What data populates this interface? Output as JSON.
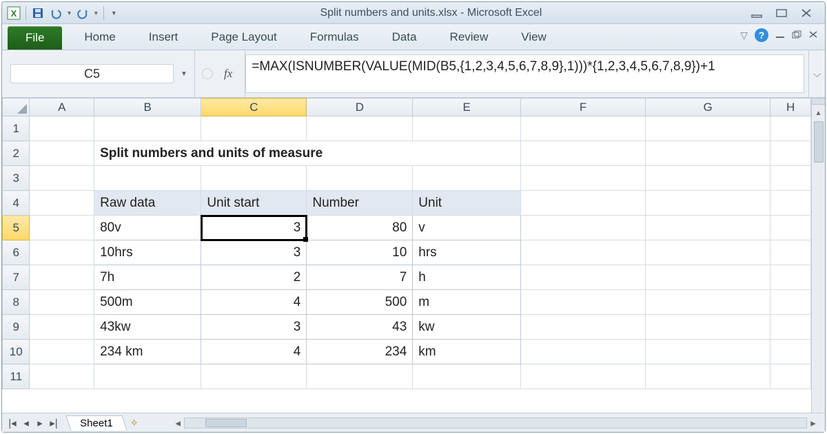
{
  "window": {
    "title": "Split numbers and units.xlsx - Microsoft Excel"
  },
  "ribbon": {
    "file": "File",
    "tabs": [
      "Home",
      "Insert",
      "Page Layout",
      "Formulas",
      "Data",
      "Review",
      "View"
    ]
  },
  "name_box": "C5",
  "fx_label": "fx",
  "formula": "=MAX(ISNUMBER(VALUE(MID(B5,{1,2,3,4,5,6,7,8,9},1)))*{1,2,3,4,5,6,7,8,9})+1",
  "columns": [
    "A",
    "B",
    "C",
    "D",
    "E",
    "F",
    "G",
    "H"
  ],
  "active_col": "C",
  "active_row": 5,
  "title_text": "Split numbers and units of measure",
  "headers": {
    "b": "Raw data",
    "c": "Unit start",
    "d": "Number",
    "e": "Unit"
  },
  "rows": [
    {
      "raw": "80v",
      "start": "3",
      "num": "80",
      "unit": "v"
    },
    {
      "raw": "10hrs",
      "start": "3",
      "num": "10",
      "unit": "hrs"
    },
    {
      "raw": "7h",
      "start": "2",
      "num": "7",
      "unit": "h"
    },
    {
      "raw": "500m",
      "start": "4",
      "num": "500",
      "unit": "m"
    },
    {
      "raw": "43kw",
      "start": "3",
      "num": "43",
      "unit": "kw"
    },
    {
      "raw": "234 km",
      "start": "4",
      "num": "234",
      "unit": "km"
    }
  ],
  "sheet_tab": "Sheet1",
  "help": "?"
}
